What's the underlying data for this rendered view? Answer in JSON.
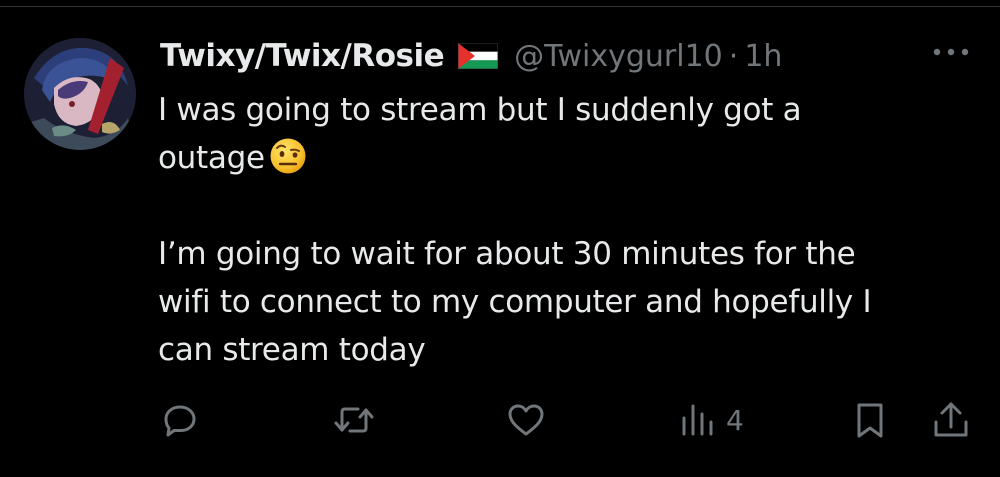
{
  "tweet": {
    "display_name": "Twixy/Twix/Rosie",
    "handle": "@Twixygurl10",
    "separator": "·",
    "time": "1h",
    "flag_icon": "palestine-flag-icon",
    "lines": [
      "I was going to stream but I suddenly got a",
      "outage",
      "I’m going to wait for about 30 minutes for  the",
      "wifi to connect to my computer and hopefully I",
      "can stream today"
    ],
    "emoji": "face-with-raised-eyebrow-emoji"
  },
  "actions": {
    "reply_icon": "reply-icon",
    "retweet_icon": "retweet-icon",
    "like_icon": "like-icon",
    "views_icon": "views-icon",
    "views_count": "4",
    "bookmark_icon": "bookmark-icon",
    "share_icon": "share-icon"
  },
  "colors": {
    "background": "#000000",
    "text": "#e7e9ea",
    "secondary": "#71767b"
  }
}
